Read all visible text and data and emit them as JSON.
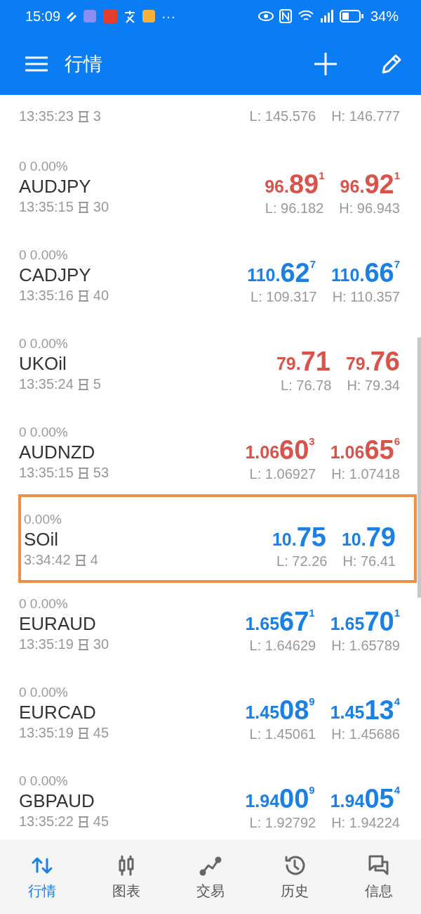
{
  "status_bar": {
    "time": "15:09",
    "more": "···",
    "battery": "34%"
  },
  "app_bar": {
    "title": "行情"
  },
  "quotes": [
    {
      "kind": "partial",
      "time": "13:35:23",
      "spread": "3",
      "low": "L: 145.576",
      "high": "H: 146.777",
      "highlighted": false
    },
    {
      "kind": "full",
      "change": "0 0.00%",
      "symbol": "AUDJPY",
      "time": "13:35:15",
      "spread": "30",
      "color": "#d9534a",
      "bid": {
        "small": "96.",
        "big": "89",
        "sup": "1"
      },
      "ask": {
        "small": "96.",
        "big": "92",
        "sup": "1"
      },
      "low": "L: 96.182",
      "high": "H: 96.943",
      "highlighted": false
    },
    {
      "kind": "full",
      "change": "0 0.00%",
      "symbol": "CADJPY",
      "time": "13:35:16",
      "spread": "40",
      "color": "#1a7fe6",
      "bid": {
        "small": "110.",
        "big": "62",
        "sup": "7"
      },
      "ask": {
        "small": "110.",
        "big": "66",
        "sup": "7"
      },
      "low": "L: 109.317",
      "high": "H: 110.357",
      "highlighted": false
    },
    {
      "kind": "full",
      "change": "0 0.00%",
      "symbol": "UKOil",
      "time": "13:35:24",
      "spread": "5",
      "color": "#d9534a",
      "bid": {
        "small": "79.",
        "big": "71"
      },
      "ask": {
        "small": "79.",
        "big": "76"
      },
      "low": "L: 76.78",
      "high": "H: 79.34",
      "highlighted": false
    },
    {
      "kind": "full",
      "change": "0 0.00%",
      "symbol": "AUDNZD",
      "time": "13:35:15",
      "spread": "53",
      "color": "#d9534a",
      "bid": {
        "small": "1.06",
        "big": "60",
        "sup": "3"
      },
      "ask": {
        "small": "1.06",
        "big": "65",
        "sup": "6"
      },
      "low": "L: 1.06927",
      "high": "H: 1.07418",
      "highlighted": false
    },
    {
      "kind": "full",
      "change": "0.00%",
      "symbol": "SOil",
      "time": "3:34:42",
      "spread": "4",
      "color": "#1a7fe6",
      "bid": {
        "small": "10.",
        "big": "75"
      },
      "ask": {
        "small": "10.",
        "big": "79"
      },
      "low": "L: 72.26",
      "high": "H: 76.41",
      "highlighted": true
    },
    {
      "kind": "full",
      "change": "0 0.00%",
      "symbol": "EURAUD",
      "time": "13:35:19",
      "spread": "30",
      "color": "#1a7fe6",
      "bid": {
        "small": "1.65",
        "big": "67",
        "sup": "1"
      },
      "ask": {
        "small": "1.65",
        "big": "70",
        "sup": "1"
      },
      "low": "L: 1.64629",
      "high": "H: 1.65789",
      "highlighted": false
    },
    {
      "kind": "full",
      "change": "0 0.00%",
      "symbol": "EURCAD",
      "time": "13:35:19",
      "spread": "45",
      "color": "#1a7fe6",
      "bid": {
        "small": "1.45",
        "big": "08",
        "sup": "9"
      },
      "ask": {
        "small": "1.45",
        "big": "13",
        "sup": "4"
      },
      "low": "L: 1.45061",
      "high": "H: 1.45686",
      "highlighted": false
    },
    {
      "kind": "full",
      "change": "0 0.00%",
      "symbol": "GBPAUD",
      "time": "13:35:22",
      "spread": "45",
      "color": "#1a7fe6",
      "bid": {
        "small": "1.94",
        "big": "00",
        "sup": "9"
      },
      "ask": {
        "small": "1.94",
        "big": "05",
        "sup": "4"
      },
      "low": "L: 1.92792",
      "high": "H: 1.94224",
      "highlighted": false
    }
  ],
  "bottom_nav": [
    {
      "kind": "quotes",
      "label": "行情",
      "selected": true
    },
    {
      "kind": "chart",
      "label": "图表",
      "selected": false
    },
    {
      "kind": "trade",
      "label": "交易",
      "selected": false
    },
    {
      "kind": "history",
      "label": "历史",
      "selected": false
    },
    {
      "kind": "messages",
      "label": "信息",
      "selected": false
    }
  ]
}
